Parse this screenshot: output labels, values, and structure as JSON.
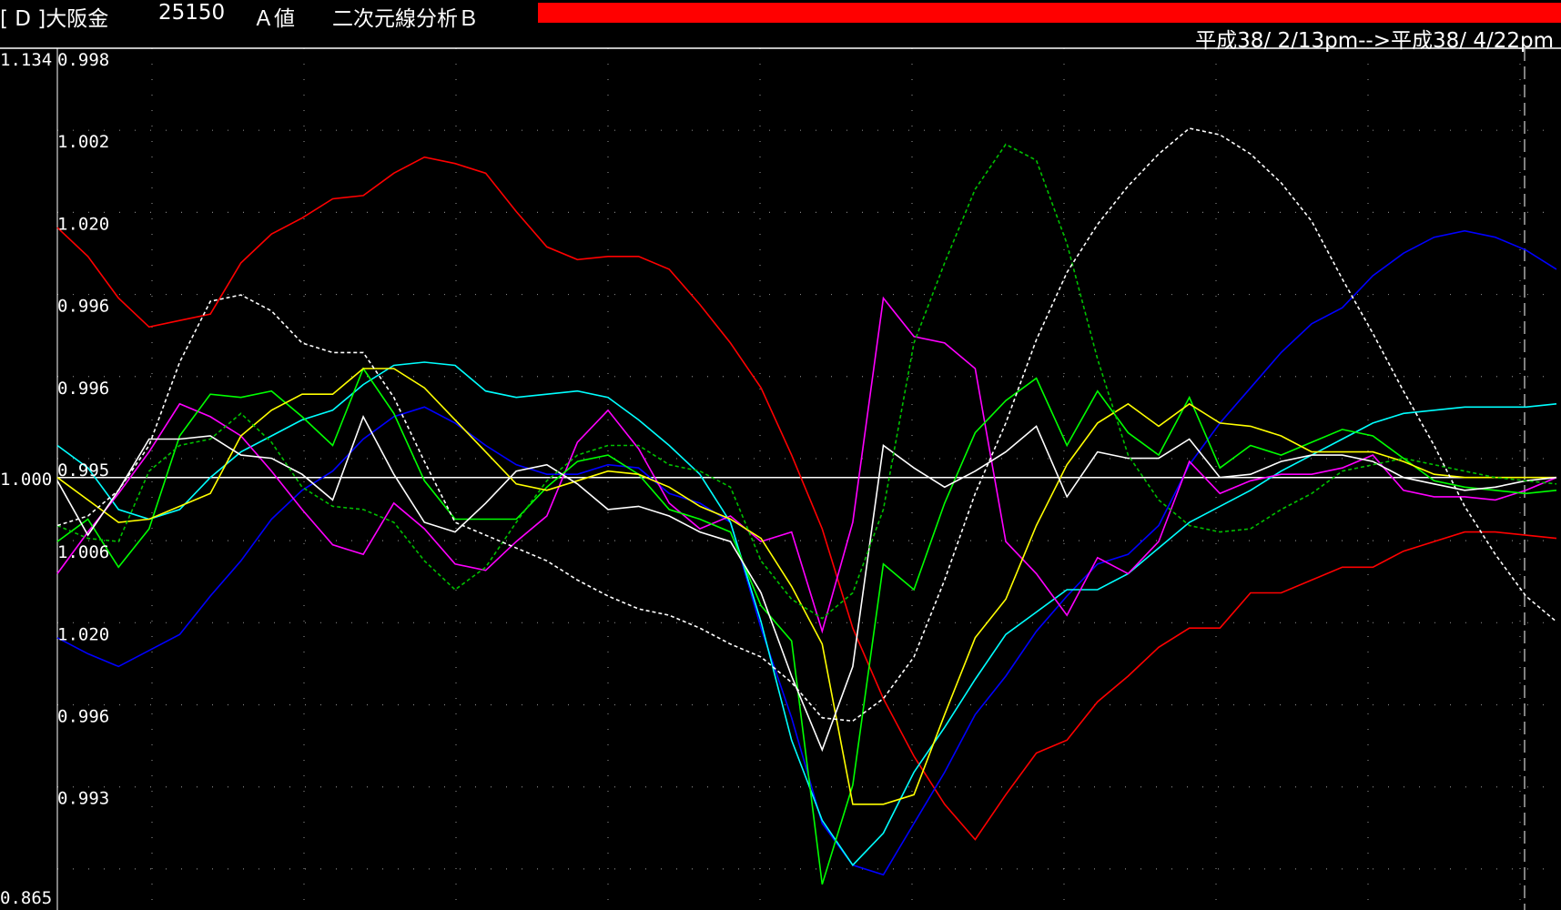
{
  "header": {
    "code": "[ D ]大阪金",
    "price": "25150",
    "mode": "Ａ値",
    "analysis": "二次元線分析Ｂ",
    "date_range": "平成38/ 2/13pm-->平成38/ 4/22pm",
    "bar_color": "#ff0000"
  },
  "chart_data": {
    "type": "line",
    "axis": {
      "top_label": "1.134",
      "bottom_label": "0.865",
      "center_label": "1.000",
      "ylim": [
        0.865,
        1.134
      ],
      "tick_labels": [
        "0.998",
        "1.002",
        "1.020",
        "0.996",
        "0.996",
        "0.995",
        "1.006",
        "1.020",
        "0.996",
        "0.993"
      ]
    },
    "reference_line": {
      "value": 1.0,
      "color": "#ffffff"
    },
    "grid": "dotted",
    "x_count": 50,
    "series": [
      {
        "color": "#ff0000",
        "dash": false,
        "values": [
          1.078,
          1.069,
          1.056,
          1.047,
          1.049,
          1.051,
          1.067,
          1.076,
          1.081,
          1.087,
          1.088,
          1.095,
          1.1,
          1.098,
          1.095,
          1.083,
          1.072,
          1.068,
          1.069,
          1.069,
          1.065,
          1.054,
          1.042,
          1.028,
          1.007,
          0.984,
          0.953,
          0.931,
          0.913,
          0.898,
          0.887,
          0.901,
          0.914,
          0.918,
          0.93,
          0.938,
          0.947,
          0.953,
          0.953,
          0.964,
          0.964,
          0.968,
          0.972,
          0.972,
          0.977,
          0.98,
          0.983,
          0.983,
          0.982,
          0.981
        ]
      },
      {
        "color": "#0000ff",
        "dash": false,
        "values": [
          0.95,
          0.945,
          0.941,
          0.946,
          0.951,
          0.963,
          0.974,
          0.987,
          0.996,
          1.002,
          1.012,
          1.019,
          1.022,
          1.017,
          1.01,
          1.004,
          1.001,
          1.001,
          1.004,
          1.003,
          0.995,
          0.992,
          0.986,
          0.953,
          0.925,
          0.892,
          0.879,
          0.876,
          0.892,
          0.908,
          0.926,
          0.938,
          0.952,
          0.963,
          0.973,
          0.976,
          0.985,
          1.004,
          1.017,
          1.028,
          1.039,
          1.048,
          1.053,
          1.063,
          1.07,
          1.075,
          1.077,
          1.075,
          1.071,
          1.065
        ]
      },
      {
        "color": "#00ffff",
        "dash": false,
        "values": [
          1.01,
          1.003,
          0.99,
          0.987,
          0.99,
          1.0,
          1.008,
          1.013,
          1.018,
          1.021,
          1.029,
          1.035,
          1.036,
          1.035,
          1.027,
          1.025,
          1.026,
          1.027,
          1.025,
          1.018,
          1.01,
          1.001,
          0.986,
          0.955,
          0.918,
          0.893,
          0.879,
          0.889,
          0.908,
          0.922,
          0.937,
          0.951,
          0.958,
          0.965,
          0.965,
          0.97,
          0.978,
          0.986,
          0.991,
          0.996,
          1.002,
          1.007,
          1.012,
          1.017,
          1.02,
          1.021,
          1.022,
          1.022,
          1.022,
          1.023
        ]
      },
      {
        "color": "#ff00ff",
        "dash": false,
        "values": [
          0.97,
          0.983,
          0.995,
          1.008,
          1.023,
          1.019,
          1.013,
          1.002,
          0.99,
          0.979,
          0.976,
          0.992,
          0.984,
          0.973,
          0.971,
          0.98,
          0.988,
          1.011,
          1.021,
          1.009,
          0.992,
          0.984,
          0.988,
          0.98,
          0.983,
          0.952,
          0.986,
          1.056,
          1.044,
          1.042,
          1.034,
          0.98,
          0.97,
          0.957,
          0.975,
          0.97,
          0.98,
          1.005,
          0.995,
          0.999,
          1.001,
          1.001,
          1.003,
          1.007,
          0.996,
          0.994,
          0.994,
          0.993,
          0.996,
          1.0
        ]
      },
      {
        "color": "#00ff00",
        "dash": false,
        "values": [
          0.98,
          0.987,
          0.972,
          0.984,
          1.013,
          1.026,
          1.025,
          1.027,
          1.019,
          1.01,
          1.034,
          1.02,
          0.999,
          0.987,
          0.987,
          0.987,
          0.997,
          1.005,
          1.007,
          1.001,
          0.99,
          0.987,
          0.983,
          0.96,
          0.949,
          0.873,
          0.904,
          0.973,
          0.965,
          0.992,
          1.014,
          1.024,
          1.031,
          1.01,
          1.027,
          1.014,
          1.007,
          1.025,
          1.003,
          1.01,
          1.007,
          1.011,
          1.015,
          1.013,
          1.006,
          0.999,
          0.997,
          0.996,
          0.995,
          0.996
        ]
      },
      {
        "color": "#ffff00",
        "dash": false,
        "values": [
          1.0,
          0.993,
          0.986,
          0.987,
          0.991,
          0.995,
          1.013,
          1.021,
          1.026,
          1.026,
          1.034,
          1.034,
          1.028,
          1.018,
          1.008,
          0.998,
          0.996,
          0.999,
          1.002,
          1.001,
          0.997,
          0.991,
          0.987,
          0.981,
          0.966,
          0.948,
          0.898,
          0.898,
          0.901,
          0.926,
          0.95,
          0.962,
          0.985,
          1.004,
          1.017,
          1.023,
          1.016,
          1.023,
          1.017,
          1.016,
          1.013,
          1.008,
          1.008,
          1.008,
          1.005,
          1.001,
          1.0,
          1.0,
          1.0,
          1.0
        ]
      },
      {
        "color": "#ffffff",
        "dash": false,
        "values": [
          0.999,
          0.982,
          0.996,
          1.012,
          1.012,
          1.013,
          1.007,
          1.006,
          1.001,
          0.993,
          1.019,
          1.001,
          0.986,
          0.983,
          0.992,
          1.002,
          1.004,
          0.998,
          0.99,
          0.991,
          0.988,
          0.983,
          0.98,
          0.964,
          0.938,
          0.915,
          0.941,
          1.01,
          1.003,
          0.997,
          1.002,
          1.008,
          1.016,
          0.994,
          1.008,
          1.006,
          1.006,
          1.012,
          1.0,
          1.001,
          1.005,
          1.007,
          1.007,
          1.005,
          1.0,
          0.998,
          0.996,
          0.997,
          0.999,
          1.0
        ]
      },
      {
        "color": "#00c000",
        "dash": true,
        "values": [
          0.985,
          0.981,
          0.98,
          1.002,
          1.01,
          1.012,
          1.02,
          1.011,
          0.997,
          0.991,
          0.99,
          0.986,
          0.974,
          0.965,
          0.972,
          0.986,
          0.999,
          1.007,
          1.01,
          1.01,
          1.004,
          1.002,
          0.997,
          0.974,
          0.962,
          0.956,
          0.964,
          0.99,
          1.042,
          1.067,
          1.09,
          1.104,
          1.099,
          1.073,
          1.037,
          1.007,
          0.993,
          0.985,
          0.983,
          0.984,
          0.99,
          0.995,
          1.002,
          1.004,
          1.006,
          1.004,
          1.002,
          1.0,
          0.999,
          0.998
        ]
      },
      {
        "color": "#ffffff",
        "dash": true,
        "values": [
          0.985,
          0.988,
          0.996,
          1.01,
          1.036,
          1.055,
          1.057,
          1.052,
          1.042,
          1.039,
          1.039,
          1.025,
          1.005,
          0.986,
          0.982,
          0.978,
          0.974,
          0.968,
          0.963,
          0.959,
          0.957,
          0.953,
          0.948,
          0.944,
          0.936,
          0.925,
          0.924,
          0.931,
          0.944,
          0.968,
          0.995,
          1.017,
          1.043,
          1.064,
          1.079,
          1.091,
          1.101,
          1.109,
          1.107,
          1.101,
          1.092,
          1.08,
          1.062,
          1.045,
          1.027,
          1.01,
          0.991,
          0.976,
          0.963,
          0.955
        ]
      }
    ]
  }
}
